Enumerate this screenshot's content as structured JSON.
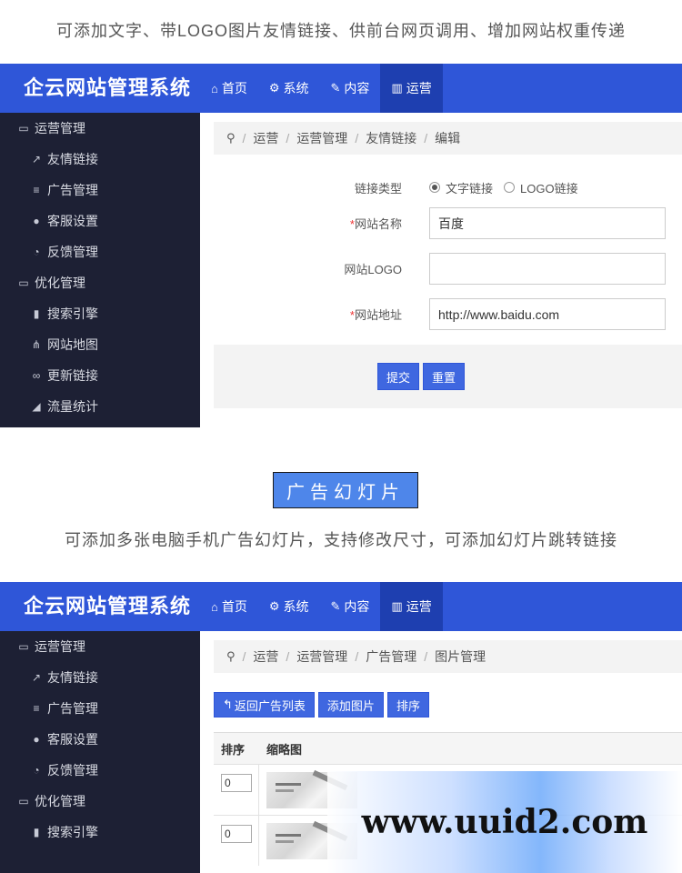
{
  "captions": {
    "top": "可添加文字、带LOGO图片友情链接、供前台网页调用、增加网站权重传递",
    "pill": "广告幻灯片",
    "middle": "可添加多张电脑手机广告幻灯片，支持修改尺寸，可添加幻灯片跳转链接"
  },
  "app": {
    "brand": "企云网站管理系统",
    "nav": [
      {
        "icon": "home-icon",
        "label": "首页"
      },
      {
        "icon": "gears-icon",
        "label": "系统"
      },
      {
        "icon": "edit-icon",
        "label": "内容"
      },
      {
        "icon": "bar-chart-icon",
        "label": "运营"
      }
    ]
  },
  "sidebar1": [
    {
      "type": "group",
      "icon": "folder-open-icon",
      "label": "运营管理"
    },
    {
      "type": "sub",
      "icon": "external-link-icon",
      "label": "友情链接"
    },
    {
      "type": "sub",
      "icon": "sliders-icon",
      "label": "广告管理"
    },
    {
      "type": "sub",
      "icon": "comments-icon",
      "label": "客服设置"
    },
    {
      "type": "sub",
      "icon": "rss-icon",
      "label": "反馈管理"
    },
    {
      "type": "group",
      "icon": "folder-open-icon",
      "label": "优化管理"
    },
    {
      "type": "sub",
      "icon": "map-icon",
      "label": "搜索引擎"
    },
    {
      "type": "sub",
      "icon": "sitemap-icon",
      "label": "网站地图"
    },
    {
      "type": "sub",
      "icon": "link-icon",
      "label": "更新链接"
    },
    {
      "type": "sub",
      "icon": "area-chart-icon",
      "label": "流量统计"
    }
  ],
  "sidebar2": [
    {
      "type": "group",
      "icon": "folder-open-icon",
      "label": "运营管理"
    },
    {
      "type": "sub",
      "icon": "external-link-icon",
      "label": "友情链接"
    },
    {
      "type": "sub",
      "icon": "sliders-icon",
      "label": "广告管理"
    },
    {
      "type": "sub",
      "icon": "comments-icon",
      "label": "客服设置"
    },
    {
      "type": "sub",
      "icon": "rss-icon",
      "label": "反馈管理"
    },
    {
      "type": "group",
      "icon": "folder-open-icon",
      "label": "优化管理"
    },
    {
      "type": "sub",
      "icon": "map-icon",
      "label": "搜索引擎"
    }
  ],
  "panel1": {
    "breadcrumb": [
      "运营",
      "运营管理",
      "友情链接",
      "编辑"
    ],
    "form": {
      "link_type_label": "链接类型",
      "radio_text": "文字链接",
      "radio_logo": "LOGO链接",
      "radio_selected": "文字链接",
      "required_mark": "*",
      "site_name_label": "网站名称",
      "site_name_value": "百度",
      "site_logo_label": "网站LOGO",
      "site_logo_value": "",
      "site_url_label": "网站地址",
      "site_url_value": "http://www.baidu.com",
      "submit": "提交",
      "reset": "重置"
    }
  },
  "panel2": {
    "breadcrumb": [
      "运营",
      "运营管理",
      "广告管理",
      "图片管理"
    ],
    "toolbar": {
      "back": "返回广告列表",
      "add": "添加图片",
      "sort": "排序"
    },
    "table": {
      "headers": [
        "排序",
        "缩略图"
      ],
      "rows": [
        {
          "sort": "0"
        },
        {
          "sort": "0"
        }
      ]
    }
  },
  "watermark": "www.uuid2.com"
}
